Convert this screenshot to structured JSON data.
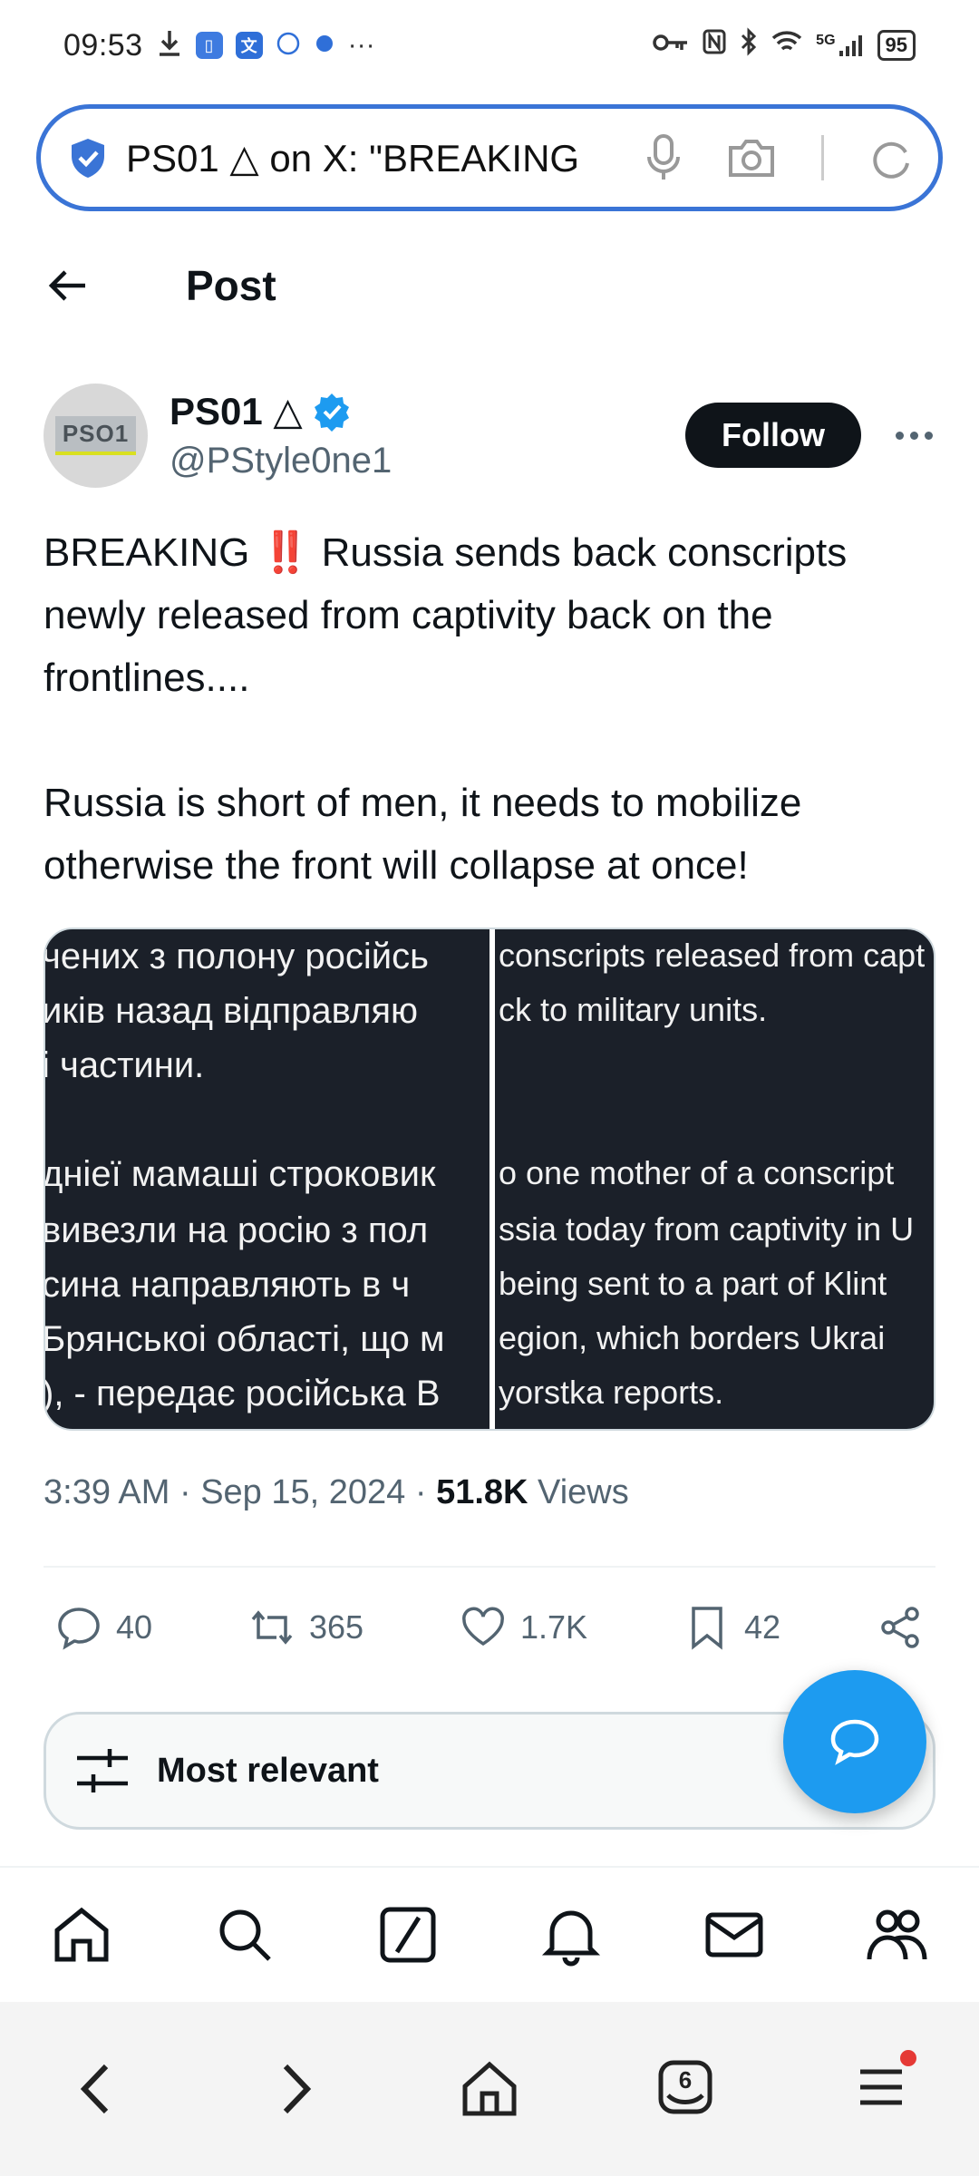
{
  "status_bar": {
    "time": "09:53",
    "battery": "95",
    "network": "5G",
    "icons": [
      "download-icon",
      "app-icon",
      "translate-icon",
      "ifly-icon",
      "app-icon",
      "more-icon",
      "key-icon",
      "nfc-icon",
      "bluetooth-icon",
      "wifi-icon",
      "signal-icon",
      "battery-icon"
    ]
  },
  "address_bar": {
    "text": "PS01 △ on X: \"BREAKING",
    "icons": [
      "shield-icon",
      "microphone-icon",
      "camera-icon",
      "refresh-icon"
    ]
  },
  "header": {
    "title": "Post"
  },
  "author": {
    "name": "PS01 △",
    "handle": "@PStyle0ne1",
    "avatar_text": "PSO1",
    "follow_label": "Follow",
    "verified": true
  },
  "tweet": {
    "paragraph1_a": "BREAKING ",
    "paragraph1_emoji": "‼️",
    "paragraph1_b": " Russia sends back conscripts newly released from captivity back on the frontlines....",
    "paragraph2": "Russia is short of men, it needs to mobilize otherwise the front will collapse at once!"
  },
  "media": {
    "left_lines": [
      "чених з полону російсь",
      "иків назад відправляю",
      "і частини.",
      "",
      "дніеї мамаші строковик",
      "вивезли на росію з пол",
      "сина направляють в ч",
      "Брянськоі області, що м",
      "), - передає російська В"
    ],
    "right_lines": [
      "conscripts released from capt",
      "ck to military units.",
      "",
      "",
      "o one mother of a conscript",
      "ssia today from captivity in U",
      "being sent to a part of Klint",
      "egion, which borders Ukrai",
      "yorstka reports."
    ]
  },
  "meta": {
    "time": "3:39 AM",
    "date": "Sep 15, 2024",
    "separator": "·",
    "views_count": "51.8K",
    "views_label": "Views"
  },
  "actions": {
    "replies": "40",
    "reposts": "365",
    "likes": "1.7K",
    "bookmarks": "42"
  },
  "sort": {
    "label": "Most relevant"
  },
  "browser": {
    "tab_count": "6"
  },
  "colors": {
    "accent": "#1d9bf0",
    "address_border": "#3a74d6",
    "text_primary": "#0f1419",
    "text_secondary": "#536471",
    "media_bg": "#1b2029"
  }
}
